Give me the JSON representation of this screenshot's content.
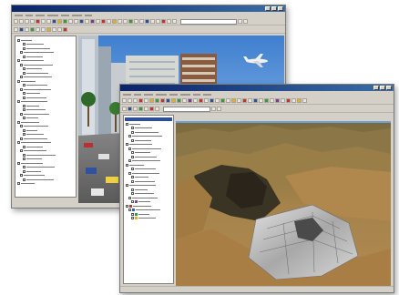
{
  "windows": {
    "city_scene": {
      "title": "",
      "menus": [
        "",
        "",
        "",
        "",
        "",
        "",
        ""
      ],
      "toc_layers": 36,
      "scene": "street-level-city-with-skyscrapers-and-airplane"
    },
    "terrain_scene": {
      "title": "",
      "menus": [
        "",
        "",
        "",
        "",
        "",
        "",
        "",
        ""
      ],
      "toc_layers": 24,
      "scene": "3d-terrain-with-draped-map"
    }
  },
  "colors": {
    "title_bar": "#0a246a",
    "window_chrome": "#d4d0c8",
    "sky": "#6aa0d8",
    "terrain": "#9a7a44"
  }
}
